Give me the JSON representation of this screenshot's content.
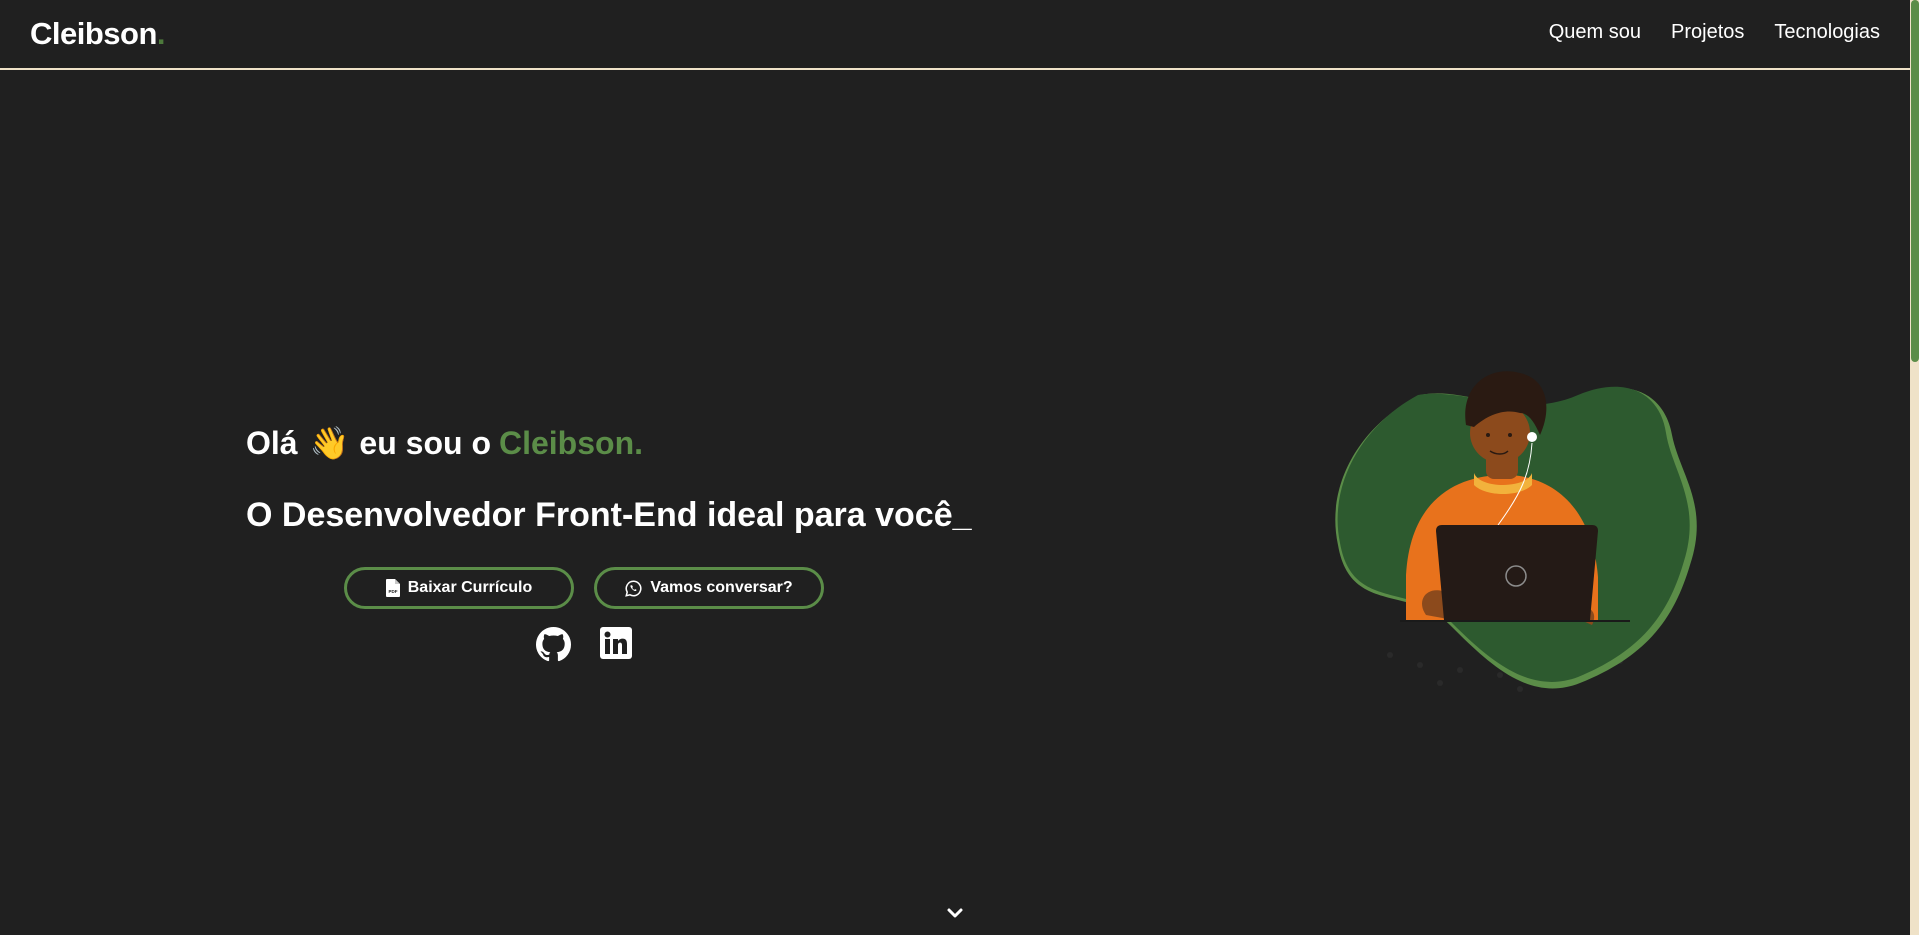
{
  "header": {
    "logo_text": "Cleibson",
    "logo_dot": ".",
    "nav": [
      {
        "label": "Quem sou"
      },
      {
        "label": "Projetos"
      },
      {
        "label": "Tecnologias"
      }
    ]
  },
  "hero": {
    "greeting": "Olá",
    "wave_emoji": "👋",
    "intro": "eu sou o",
    "name": "Cleibson.",
    "subtitle": "O Desenvolvedor Front-End ideal para você_",
    "buttons": {
      "cv_label": "Baixar Currículo",
      "chat_label": "Vamos conversar?"
    },
    "social_icons": [
      "github-icon",
      "linkedin-icon"
    ]
  },
  "colors": {
    "background": "#202020",
    "accent": "#5b8d48",
    "header_border": "#efe2c8",
    "text": "#ffffff"
  },
  "icons": {
    "cv_button": "pdf-file-icon",
    "chat_button": "whatsapp-icon",
    "scroll_down": "chevron-down-icon"
  }
}
